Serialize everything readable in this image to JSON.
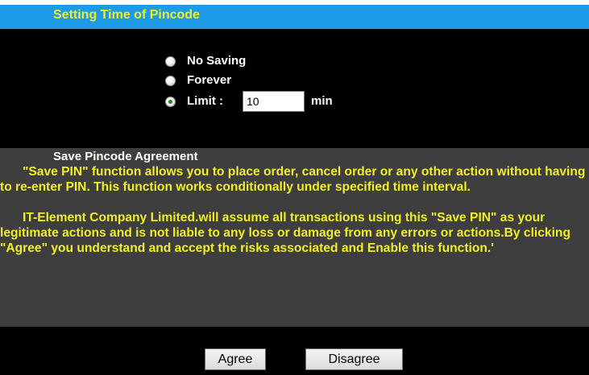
{
  "header": {
    "title": "Setting Time of Pincode"
  },
  "options": [
    {
      "label": "No Saving",
      "selected": false
    },
    {
      "label": "Forever",
      "selected": false
    },
    {
      "label": "Limit :",
      "selected": true
    }
  ],
  "limit": {
    "value": "10",
    "unit": "min"
  },
  "agreement": {
    "heading": "Save Pincode Agreement",
    "paragraph1": "\"Save PIN\" function allows you to place order, cancel order or any other action without having to re-enter PIN. This function works conditionally under specified time interval.",
    "paragraph2": "IT-Element Company Limited.will assume all transactions using this \"Save PIN\" as your legitimate actions and is not liable to any loss or damage from any errors or actions.By clicking \"Agree\" you understand and accept the risks associated and Enable this function.'"
  },
  "buttons": {
    "agree": "Agree",
    "disagree": "Disagree"
  },
  "colors": {
    "title_bar": "#1e9be6",
    "title_text": "#f2ee28",
    "background": "#000000",
    "agreement_bg": "#3e3e3e",
    "agreement_text": "#f2ee28"
  }
}
